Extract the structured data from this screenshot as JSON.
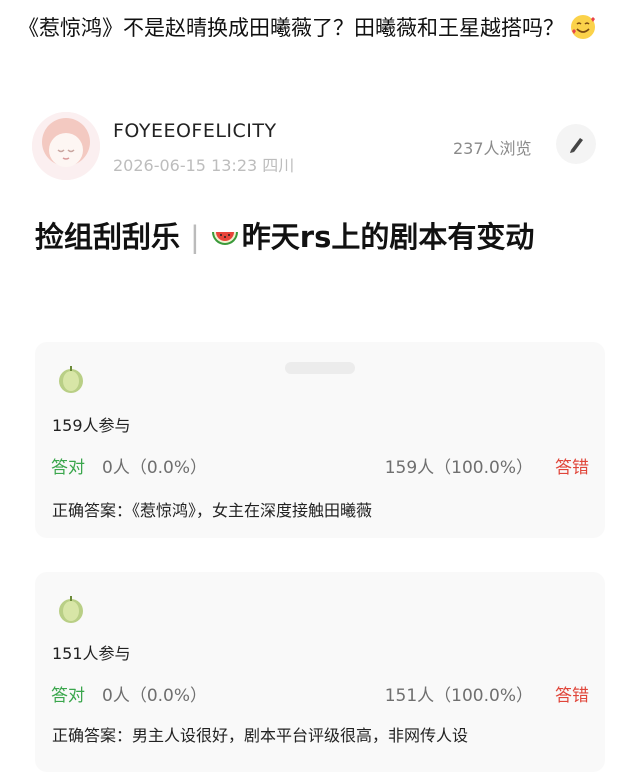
{
  "post": {
    "headline": "《惹惊鸿》不是赵晴换成田曦薇了？田曦薇和王星越搭吗？",
    "headline_emoji": "smiling-face-with-hearts-icon"
  },
  "author": {
    "name": "FOYEEOFELICITY",
    "meta": "2026-06-15 13:23 四川",
    "views": "237人浏览"
  },
  "article": {
    "title_prefix": "捡组刮刮乐",
    "separator": "|",
    "title_rest": "昨天rs上的剧本有变动"
  },
  "quizzes": [
    {
      "participants": "159人参与",
      "right_label": "答对",
      "right_value": "0人（0.0%）",
      "wrong_value": "159人（100.0%）",
      "wrong_label": "答错",
      "answer": "正确答案：《惹惊鸿》，女主在深度接触田曦薇"
    },
    {
      "participants": "151人参与",
      "right_label": "答对",
      "right_value": "0人（0.0%）",
      "wrong_value": "151人（100.0%）",
      "wrong_label": "答错",
      "answer": "正确答案：男主人设很好，剧本平台评级很高，非网传人设"
    }
  ],
  "colors": {
    "right": "#3aa64c",
    "wrong": "#e0463a",
    "card_bg": "#f9f9f9"
  }
}
